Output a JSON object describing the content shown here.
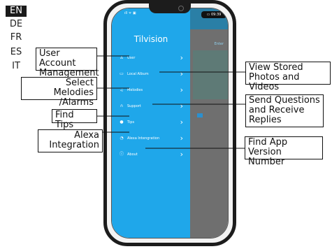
{
  "languages": [
    {
      "code": "EN",
      "active": true
    },
    {
      "code": "DE",
      "active": false
    },
    {
      "code": "FR",
      "active": false
    },
    {
      "code": "ES",
      "active": false
    },
    {
      "code": "IT",
      "active": false
    }
  ],
  "status_bar": {
    "left": "ıll ᯤ ▣",
    "right": "▭ 09:39"
  },
  "app": {
    "title": "Tilvision",
    "menu": [
      {
        "label": "User",
        "icon": "user-icon"
      },
      {
        "label": "Local Album",
        "icon": "album-icon"
      },
      {
        "label": "Melodies",
        "icon": "music-icon"
      },
      {
        "label": "Support",
        "icon": "headset-icon"
      },
      {
        "label": "Tips",
        "icon": "bulb-icon"
      },
      {
        "label": "Alexa Intengration",
        "icon": "alexa-icon"
      },
      {
        "label": "About",
        "icon": "info-icon"
      }
    ],
    "background_edit": "Enter"
  },
  "callouts": {
    "user": "User Account Management",
    "album": "View Stored Photos and Videos",
    "melodies": "Select Melodies /Alarms",
    "support": "Send Questions and Receive Replies",
    "tips": "Find Tips",
    "alexa": "Alexa Integration",
    "about": "Find App Version Number"
  }
}
